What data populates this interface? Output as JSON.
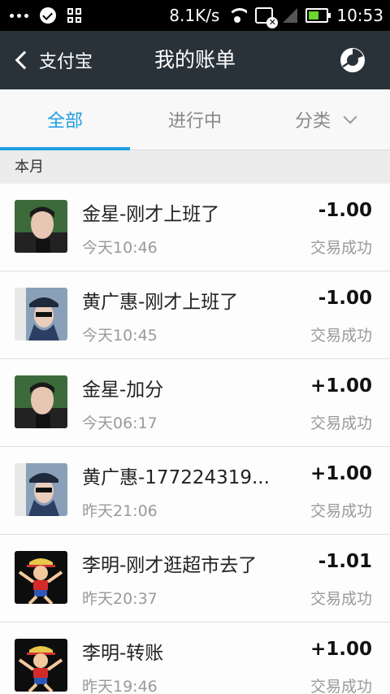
{
  "statusbar": {
    "speed": "8.1K/s",
    "time": "10:53"
  },
  "header": {
    "back_label": "支付宝",
    "title": "我的账单"
  },
  "tabs": [
    {
      "label": "全部"
    },
    {
      "label": "进行中"
    },
    {
      "label": "分类"
    }
  ],
  "section_label": "本月",
  "bills": [
    {
      "name": "金星-刚才上班了",
      "time": "今天10:46",
      "amount": "-1.00",
      "status": "交易成功",
      "avatar": "man-photo"
    },
    {
      "name": "黄广惠-刚才上班了",
      "time": "今天10:45",
      "amount": "-1.00",
      "status": "交易成功",
      "avatar": "woman-cap-photo"
    },
    {
      "name": "金星-加分",
      "time": "今天06:17",
      "amount": "+1.00",
      "status": "交易成功",
      "avatar": "man-photo"
    },
    {
      "name": "黄广惠-177224319...",
      "time": "昨天21:06",
      "amount": "+1.00",
      "status": "交易成功",
      "avatar": "woman-cap-photo"
    },
    {
      "name": "李明-刚才逛超市去了",
      "time": "昨天20:37",
      "amount": "-1.01",
      "status": "交易成功",
      "avatar": "cartoon-pirate"
    },
    {
      "name": "李明-转账",
      "time": "昨天19:46",
      "amount": "+1.00",
      "status": "交易成功",
      "avatar": "cartoon-pirate"
    }
  ],
  "colors": {
    "accent": "#1e9de3",
    "header_bg": "#2a3239"
  }
}
